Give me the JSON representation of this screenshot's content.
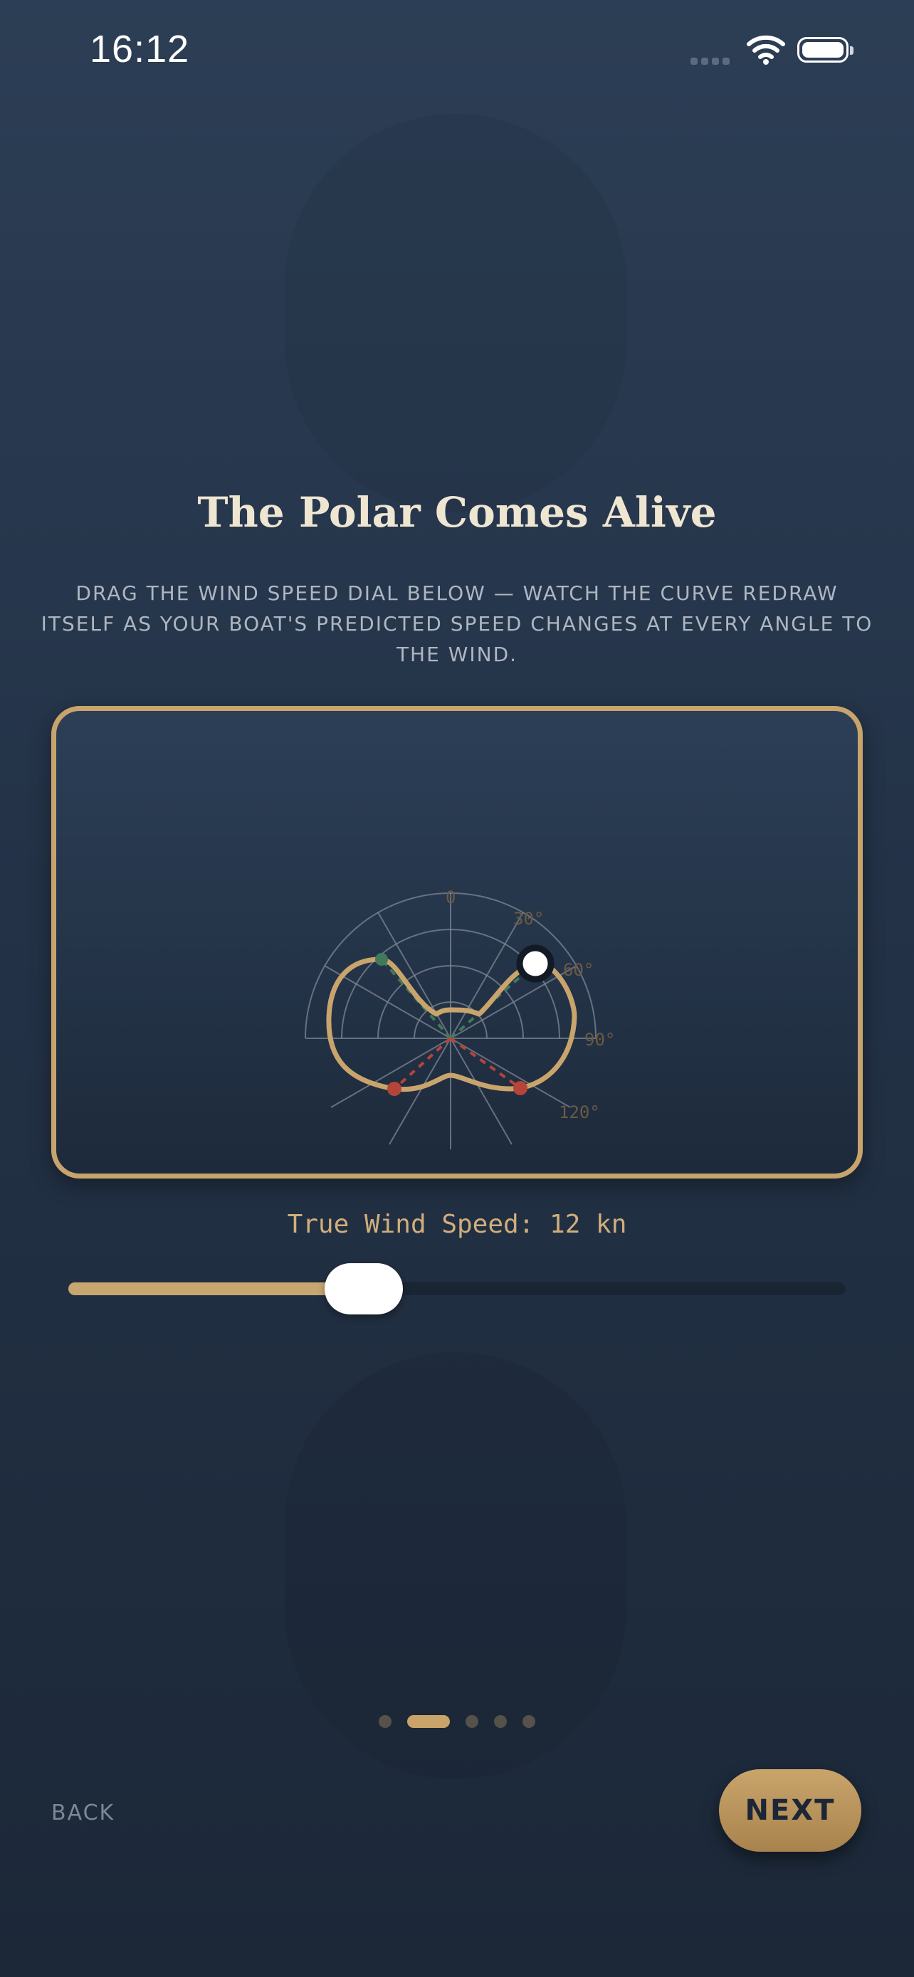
{
  "status_bar": {
    "time": "16:12"
  },
  "slide": {
    "title": "The Polar Comes Alive",
    "subtitle": "DRAG THE WIND SPEED DIAL BELOW — WATCH THE CURVE REDRAW ITSELF AS YOUR BOAT'S PREDICTED SPEED CHANGES AT EVERY ANGLE TO THE WIND."
  },
  "polar": {
    "angle_labels": [
      "0",
      "30°",
      "60°",
      "90°",
      "120°"
    ],
    "colors": {
      "curve": "#c9a46c",
      "upwind": "#3f7a5a",
      "downwind": "#b5443b",
      "grid": "#7e8794"
    }
  },
  "wind": {
    "label_prefix": "True Wind Speed: ",
    "value": 12,
    "unit": "kn",
    "label": "True Wind Speed: 12 kn",
    "slider_fraction": 0.38
  },
  "pagination": {
    "count": 5,
    "active_index": 1
  },
  "nav": {
    "back_label": "BACK",
    "next_label": "NEXT"
  },
  "colors": {
    "accent": "#c8a46c",
    "background": "#233247"
  }
}
